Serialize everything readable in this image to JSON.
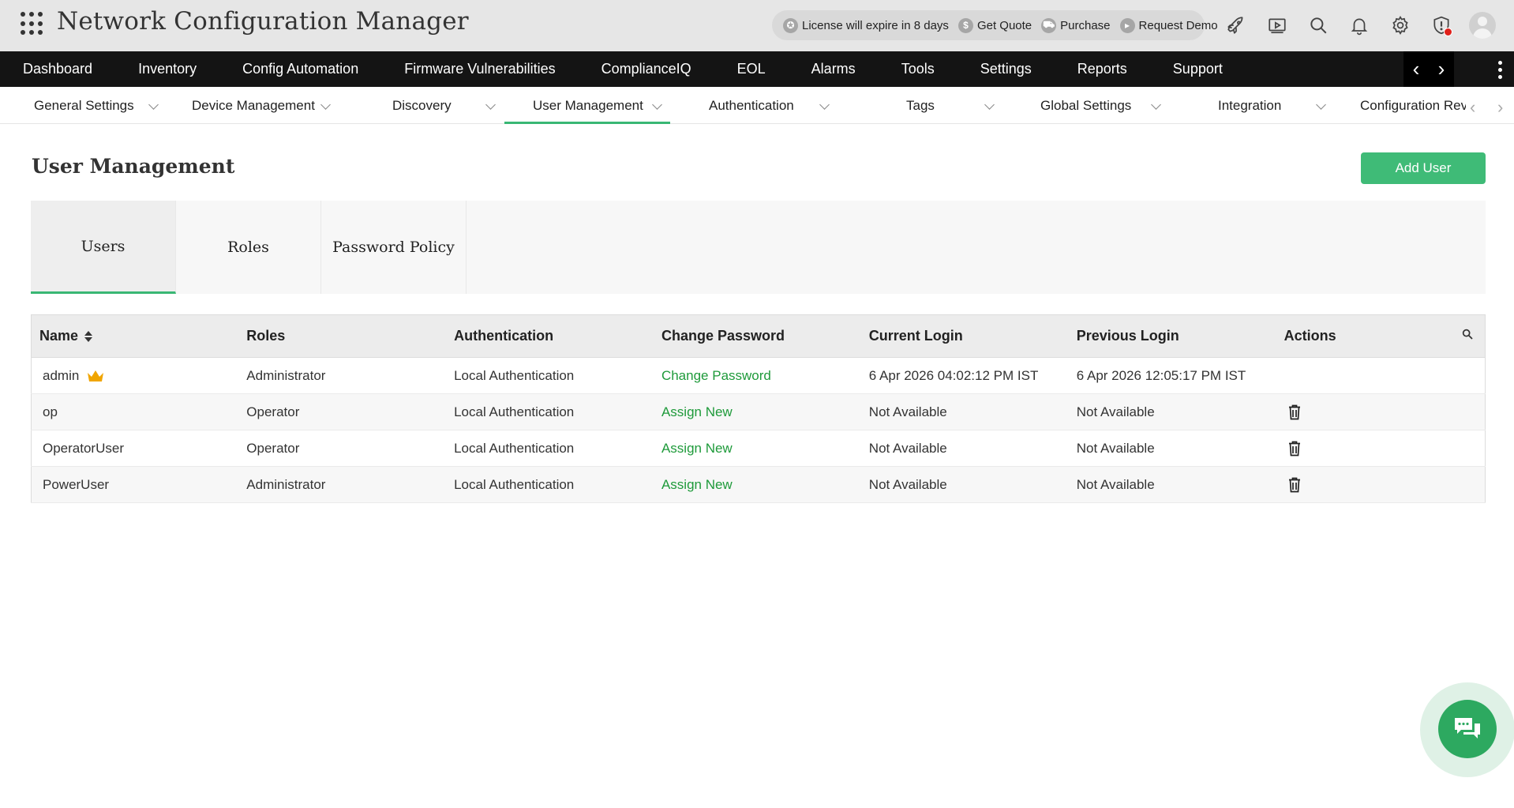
{
  "header": {
    "app_title": "Network Configuration Manager",
    "license_text": "License will expire in 8 days",
    "get_quote": "Get Quote",
    "purchase": "Purchase",
    "request_demo": "Request Demo",
    "icons": [
      "rocket-icon",
      "video-icon",
      "search-icon",
      "bell-icon",
      "gear-icon",
      "shield-alert-icon",
      "avatar"
    ],
    "alert_color": "#e0201a"
  },
  "main_nav": {
    "items": [
      "Dashboard",
      "Inventory",
      "Config Automation",
      "Firmware Vulnerabilities",
      "ComplianceIQ",
      "EOL",
      "Alarms",
      "Tools",
      "Settings",
      "Reports",
      "Support"
    ],
    "arrow_left": "‹",
    "arrow_right": "›"
  },
  "sub_nav": {
    "items": [
      "General Settings",
      "Device Management",
      "Discovery",
      "User Management",
      "Authentication",
      "Tags",
      "Global Settings",
      "Integration",
      "Configuration Rev"
    ],
    "active": "User Management",
    "scroll_left": "‹",
    "scroll_right": "›"
  },
  "page": {
    "title": "User Management",
    "add_user_label": "Add User",
    "accent_color": "#3fbb77"
  },
  "tabs": {
    "items": [
      "Users",
      "Roles",
      "Password Policy"
    ],
    "active": "Users"
  },
  "table": {
    "columns": [
      "Name",
      "Roles",
      "Authentication",
      "Change Password",
      "Current Login",
      "Previous Login",
      "Actions"
    ],
    "rows": [
      {
        "name": "admin",
        "role": "Administrator",
        "auth": "Local Authentication",
        "password_action": "Change Password",
        "current_login": "6 Apr 2026 04:02:12 PM IST",
        "previous_login": "6 Apr 2026 12:05:17 PM IST",
        "crown": true,
        "deletable": false
      },
      {
        "name": "op",
        "role": "Operator",
        "auth": "Local Authentication",
        "password_action": "Assign New",
        "current_login": "Not Available",
        "previous_login": "Not Available",
        "crown": false,
        "deletable": true
      },
      {
        "name": "OperatorUser",
        "role": "Operator",
        "auth": "Local Authentication",
        "password_action": "Assign New",
        "current_login": "Not Available",
        "previous_login": "Not Available",
        "crown": false,
        "deletable": true
      },
      {
        "name": "PowerUser",
        "role": "Administrator",
        "auth": "Local Authentication",
        "password_action": "Assign New",
        "current_login": "Not Available",
        "previous_login": "Not Available",
        "crown": false,
        "deletable": true
      }
    ],
    "link_color": "#1e9a3a"
  },
  "chat": {
    "icon": "chat-icon"
  }
}
